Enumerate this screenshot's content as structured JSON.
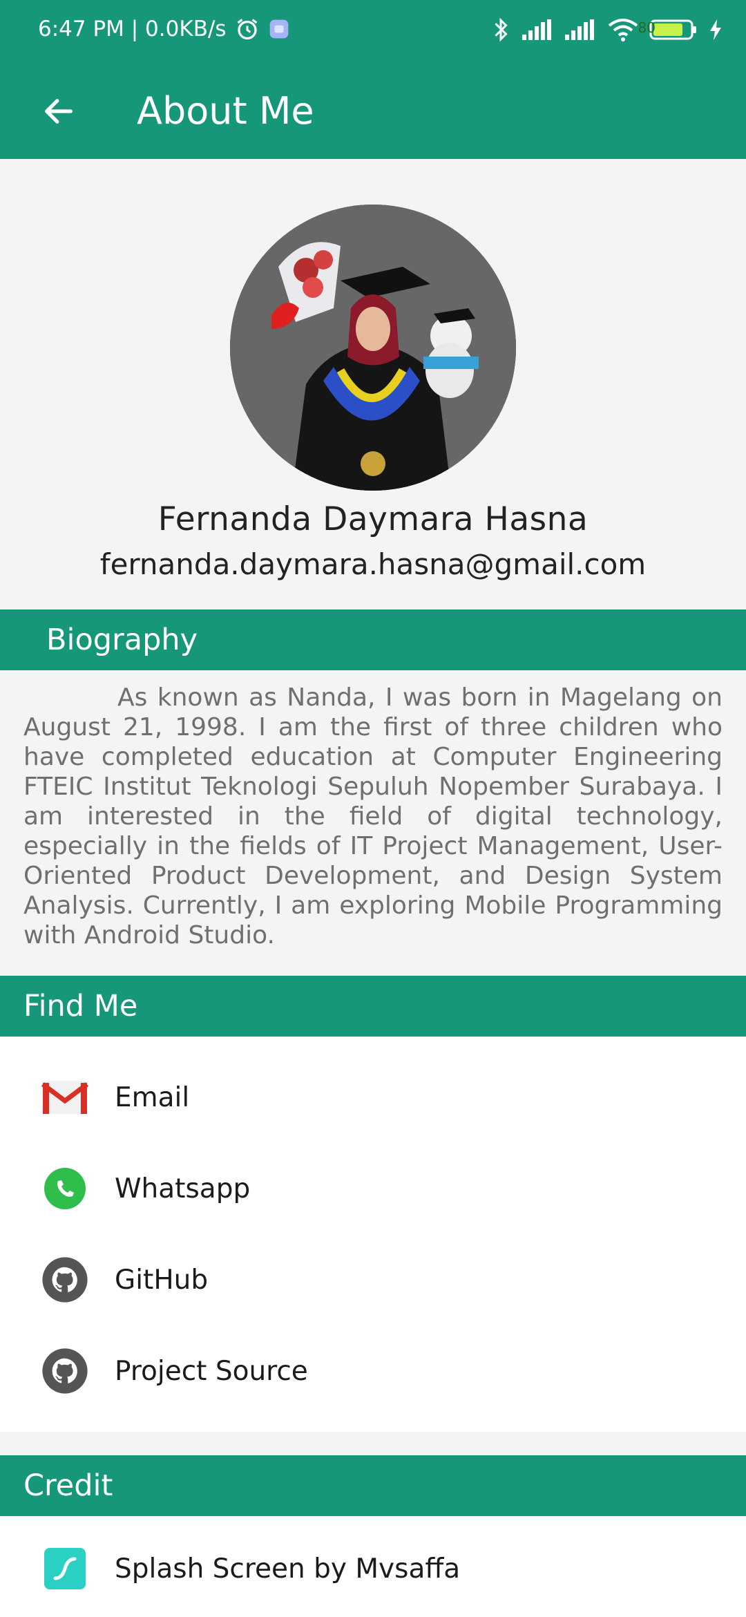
{
  "status_bar": {
    "time_and_speed": "6:47 PM | 0.0KB/s",
    "battery": "80"
  },
  "app_bar": {
    "title": "About Me",
    "back_icon": "arrow-left-icon"
  },
  "profile": {
    "name": "Fernanda Daymara Hasna",
    "email": "fernanda.daymara.hasna@gmail.com"
  },
  "biography": {
    "header": "Biography",
    "text": "As known as Nanda, I was born in Magelang on August 21, 1998. I am the first of three children who have completed education at Computer Engineering FTEIC Institut Teknologi Sepuluh Nopember Surabaya. I am interested in the field of digital technology, especially in the fields of IT Project Management, User-Oriented Product Development, and Design System Analysis. Currently, I am exploring Mobile Programming with Android Studio."
  },
  "find_me": {
    "header": "Find Me",
    "items": [
      {
        "label": "Email",
        "icon": "gmail-icon"
      },
      {
        "label": "Whatsapp",
        "icon": "whatsapp-icon"
      },
      {
        "label": "GitHub",
        "icon": "github-icon"
      },
      {
        "label": "Project Source",
        "icon": "github-icon"
      }
    ]
  },
  "credit": {
    "header": "Credit",
    "items": [
      {
        "label": "Splash Screen by Mvsaffa",
        "icon": "lottie-icon"
      }
    ]
  },
  "colors": {
    "primary": "#16977a",
    "background": "#f4f4f4",
    "body_text": "#6f6f6f"
  }
}
